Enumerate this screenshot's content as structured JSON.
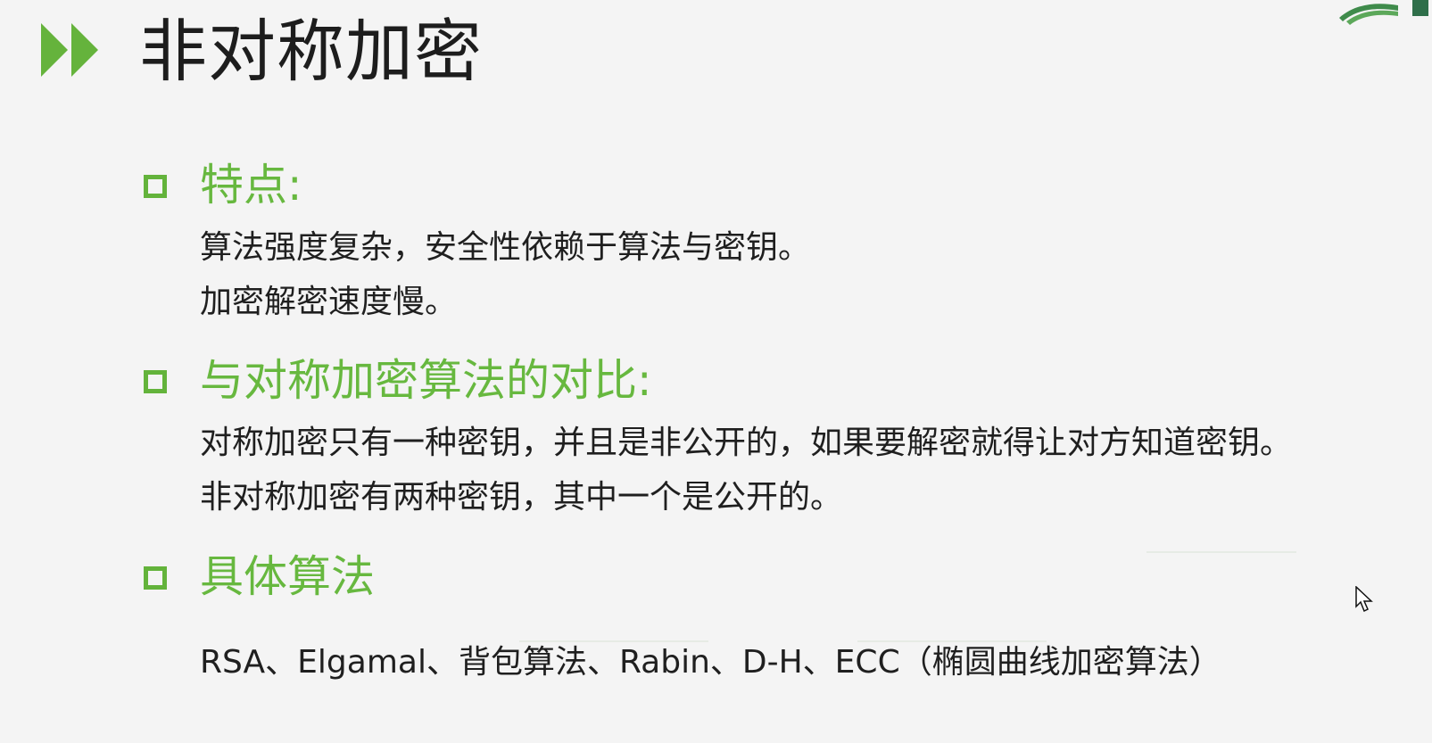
{
  "slide": {
    "title": "非对称加密",
    "sections": [
      {
        "heading": "特点:",
        "lines": [
          "算法强度复杂，安全性依赖于算法与密钥。",
          "加密解密速度慢。"
        ]
      },
      {
        "heading": "与对称加密算法的对比:",
        "lines": [
          "对称加密只有一种密钥，并且是非公开的，如果要解密就得让对方知道密钥。",
          "非对称加密有两种密钥，其中一个是公开的。"
        ]
      },
      {
        "heading": "具体算法",
        "lines": [
          "RSA、Elgamal、背包算法、Rabin、D-H、ECC（椭圆曲线加密算法）"
        ]
      }
    ]
  },
  "colors": {
    "accent": "#67b83f",
    "title_text": "#1d1d1d",
    "body_text": "#1f1f1f",
    "background": "#f4f4f4"
  },
  "icons": {
    "title_marker": "double-triangle-icon",
    "bullet_marker": "hollow-square-icon",
    "cursor": "mouse-pointer-icon",
    "logo": "logo-fragment-icon"
  }
}
